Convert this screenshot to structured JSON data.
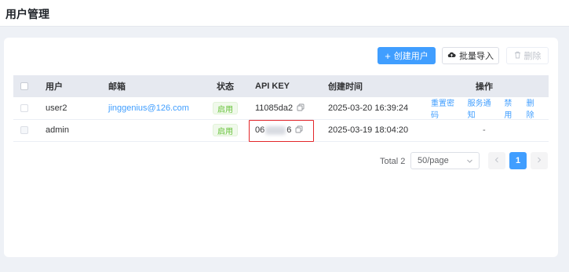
{
  "header": {
    "title": "用户管理"
  },
  "toolbar": {
    "create_label": "创建用户",
    "import_label": "批量导入",
    "delete_label": "删除"
  },
  "table": {
    "columns": {
      "user": "用户",
      "email": "邮箱",
      "status": "状态",
      "api_key": "API KEY",
      "created": "创建时间",
      "actions": "操作"
    },
    "rows": [
      {
        "user": "user2",
        "email": "jinggenius@126.com",
        "status": "启用",
        "api_key": "11085da2",
        "created": "2025-03-20 16:39:24",
        "actions": [
          "重置密码",
          "服务通知",
          "禁用",
          "删除"
        ]
      },
      {
        "user": "admin",
        "email": "",
        "status": "启用",
        "api_key_prefix": "06",
        "api_key_suffix": "6",
        "created": "2025-03-19 18:04:20",
        "actions_placeholder": "-"
      }
    ]
  },
  "pagination": {
    "total": "Total 2",
    "page_size": "50/page",
    "current_page": "1",
    "prev_icon": "chevron-left-icon",
    "next_icon": "chevron-right-icon"
  },
  "colors": {
    "primary": "#409eff",
    "success": "#67c23a",
    "highlight_box": "#e3262a"
  }
}
